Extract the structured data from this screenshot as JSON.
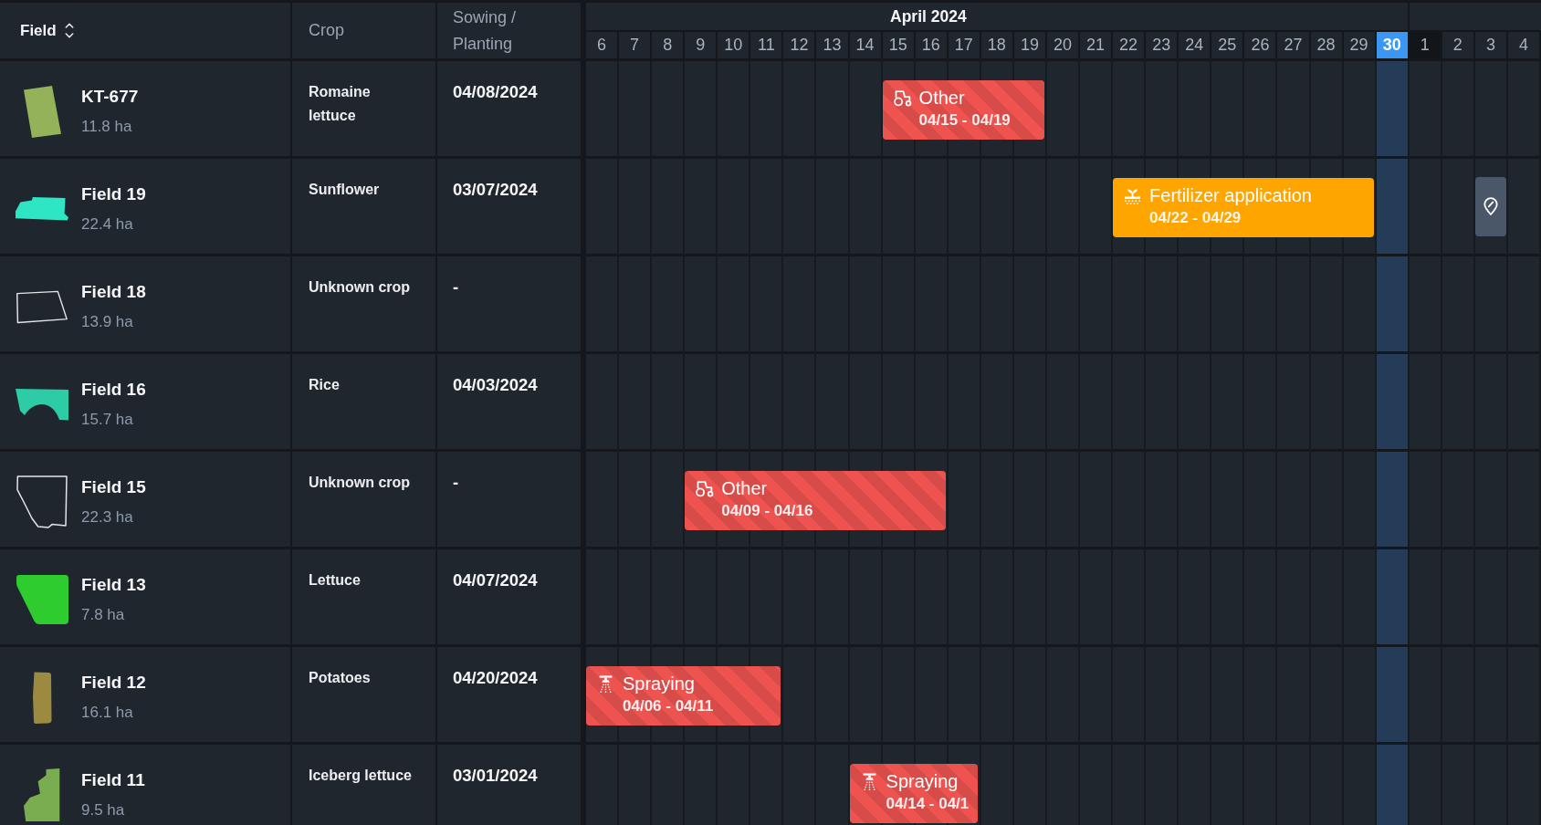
{
  "table": {
    "columns": [
      {
        "label": "Field",
        "sortable": true
      },
      {
        "label": "Crop",
        "sortable": false
      },
      {
        "label": "Sowing / Planting",
        "sortable": false
      }
    ]
  },
  "timeline": {
    "months": [
      {
        "label": "April 2024",
        "days": [
          {
            "label": "6",
            "today": false,
            "shaded": false
          },
          {
            "label": "7",
            "today": false,
            "shaded": false
          },
          {
            "label": "8",
            "today": false,
            "shaded": false
          },
          {
            "label": "9",
            "today": false,
            "shaded": false
          },
          {
            "label": "10",
            "today": false,
            "shaded": false
          },
          {
            "label": "11",
            "today": false,
            "shaded": false
          },
          {
            "label": "12",
            "today": false,
            "shaded": false
          },
          {
            "label": "13",
            "today": false,
            "shaded": false
          },
          {
            "label": "14",
            "today": false,
            "shaded": false
          },
          {
            "label": "15",
            "today": false,
            "shaded": false
          },
          {
            "label": "16",
            "today": false,
            "shaded": false
          },
          {
            "label": "17",
            "today": false,
            "shaded": false
          },
          {
            "label": "18",
            "today": false,
            "shaded": false
          },
          {
            "label": "19",
            "today": false,
            "shaded": false
          },
          {
            "label": "20",
            "today": false,
            "shaded": false
          },
          {
            "label": "21",
            "today": false,
            "shaded": false
          },
          {
            "label": "22",
            "today": false,
            "shaded": false
          },
          {
            "label": "23",
            "today": false,
            "shaded": false
          },
          {
            "label": "24",
            "today": false,
            "shaded": false
          },
          {
            "label": "25",
            "today": false,
            "shaded": false
          },
          {
            "label": "26",
            "today": false,
            "shaded": false
          },
          {
            "label": "27",
            "today": false,
            "shaded": false
          },
          {
            "label": "28",
            "today": false,
            "shaded": false
          },
          {
            "label": "29",
            "today": false,
            "shaded": false
          },
          {
            "label": "30",
            "today": true,
            "shaded": false
          }
        ]
      },
      {
        "days": [
          {
            "label": "1",
            "today": false,
            "shaded": true
          },
          {
            "label": "2",
            "today": false,
            "shaded": false
          },
          {
            "label": "3",
            "today": false,
            "shaded": false
          },
          {
            "label": "4",
            "today": false,
            "shaded": false
          }
        ]
      }
    ]
  },
  "rows": [
    {
      "field": {
        "name": "KT-677",
        "area": "11.8 ha",
        "shape": {
          "kind": "filled",
          "color": "#93b25a"
        }
      },
      "crop": "Romaine lettuce",
      "sowing_date": "04/08/2024",
      "tasks": [
        {
          "kind": "other",
          "title": "Other",
          "dates": "04/15 - 04/19",
          "color": "#ef5350",
          "striped": true
        }
      ]
    },
    {
      "field": {
        "name": "Field 19",
        "area": "22.4 ha",
        "shape": {
          "kind": "filled",
          "color": "#2ee5c4"
        }
      },
      "crop": "Sunflower",
      "sowing_date": "03/07/2024",
      "tasks": [
        {
          "kind": "fertilizer",
          "title": "Fertilizer application",
          "dates": "04/22 - 04/29",
          "color": "#ffa500",
          "striped": false
        }
      ],
      "pin_by_day": [
        false,
        false,
        false,
        false,
        false,
        false,
        false,
        false,
        false,
        false,
        false,
        false,
        false,
        false,
        false,
        false,
        false,
        false,
        false,
        false,
        false,
        false,
        false,
        false,
        false,
        false,
        false,
        true,
        false
      ]
    },
    {
      "field": {
        "name": "Field 18",
        "area": "13.9 ha",
        "shape": {
          "kind": "outline"
        }
      },
      "crop": "Unknown crop",
      "sowing_date": "-"
    },
    {
      "field": {
        "name": "Field 16",
        "area": "15.7 ha",
        "shape": {
          "kind": "filled",
          "color": "#2dcca6"
        }
      },
      "crop": "Rice",
      "sowing_date": "04/03/2024"
    },
    {
      "field": {
        "name": "Field 15",
        "area": "22.3 ha",
        "shape": {
          "kind": "outline"
        }
      },
      "crop": "Unknown crop",
      "sowing_date": "-",
      "tasks": [
        {
          "kind": "other",
          "title": "Other",
          "dates": "04/09 - 04/16",
          "color": "#ef5350",
          "striped": true
        }
      ]
    },
    {
      "field": {
        "name": "Field 13",
        "area": "7.8 ha",
        "shape": {
          "kind": "filled",
          "color": "#2ecc2e"
        }
      },
      "crop": "Lettuce",
      "sowing_date": "04/07/2024"
    },
    {
      "field": {
        "name": "Field 12",
        "area": "16.1 ha",
        "shape": {
          "kind": "filled",
          "color": "#9b8a3f"
        }
      },
      "crop": "Potatoes",
      "sowing_date": "04/20/2024",
      "tasks": [
        {
          "kind": "spraying",
          "title": "Spraying",
          "dates": "04/06 - 04/11",
          "color": "#ef5350",
          "striped": true
        }
      ]
    },
    {
      "field": {
        "name": "Field 11",
        "area": "9.5 ha",
        "shape": {
          "kind": "filled",
          "color": "#7aac50"
        }
      },
      "crop": "Iceberg lettuce",
      "sowing_date": "03/01/2024",
      "tasks": [
        {
          "kind": "spraying",
          "title": "Spraying",
          "dates": "04/14 - 04/1",
          "color": "#ef5350",
          "striped": true
        }
      ]
    }
  ]
}
